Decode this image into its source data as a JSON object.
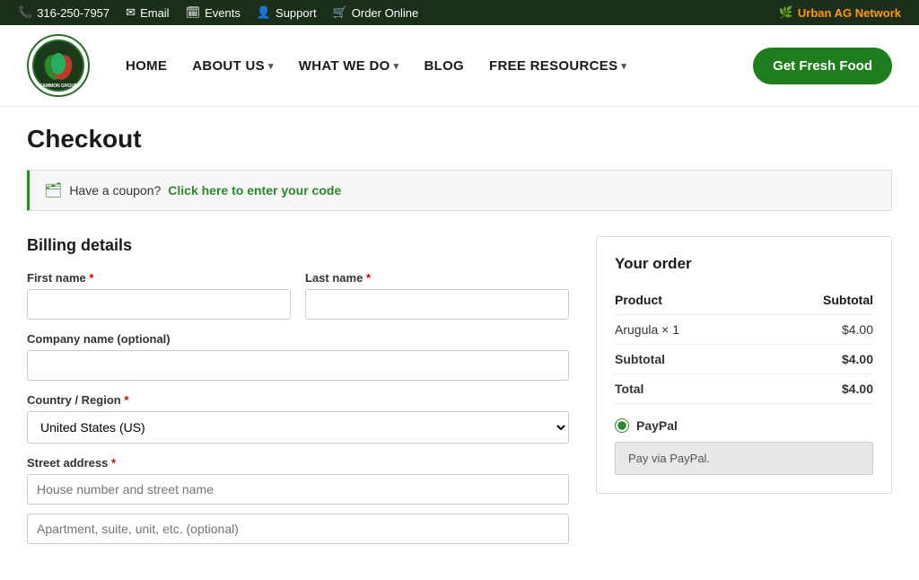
{
  "topbar": {
    "phone": "316-250-7957",
    "email": "Email",
    "events": "Events",
    "support": "Support",
    "order_online": "Order Online",
    "network": "Urban AG Network"
  },
  "header": {
    "get_fresh_label": "Get Fresh Food"
  },
  "nav": {
    "items": [
      {
        "label": "HOME",
        "has_dropdown": false
      },
      {
        "label": "ABOUT US",
        "has_dropdown": true
      },
      {
        "label": "WHAT WE DO",
        "has_dropdown": true
      },
      {
        "label": "BLOG",
        "has_dropdown": false
      },
      {
        "label": "FREE RESOURCES",
        "has_dropdown": true
      }
    ]
  },
  "page": {
    "title": "Checkout"
  },
  "coupon": {
    "text": "Have a coupon?",
    "link_text": "Click here to enter your code"
  },
  "billing": {
    "section_title": "Billing details",
    "first_name_label": "First name",
    "last_name_label": "Last name",
    "company_label": "Company name (optional)",
    "country_label": "Country / Region",
    "country_value": "United States (US)",
    "street_label": "Street address",
    "street_placeholder": "House number and street name",
    "apt_placeholder": "Apartment, suite, unit, etc. (optional)"
  },
  "order": {
    "title": "Your order",
    "product_header": "Product",
    "subtotal_header": "Subtotal",
    "product_name": "Arugula",
    "product_qty": "× 1",
    "product_price": "$4.00",
    "subtotal_label": "Subtotal",
    "subtotal_value": "$4.00",
    "total_label": "Total",
    "total_value": "$4.00"
  },
  "payment": {
    "method_label": "PayPal",
    "pay_button_label": "Pay via PayPal."
  }
}
